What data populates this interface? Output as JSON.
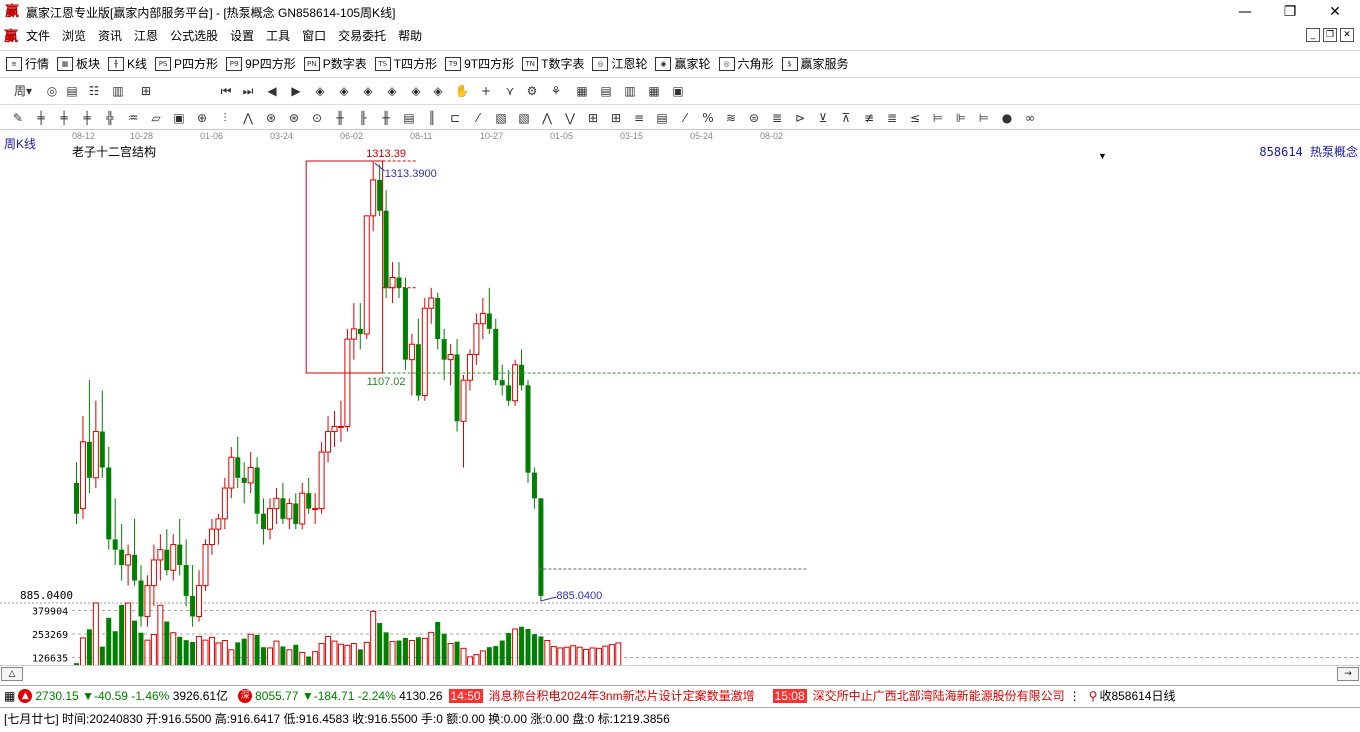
{
  "window": {
    "title": "赢家江恩专业版[赢家内部服务平台] - [热泵概念  GN858614-105周K线]",
    "app_logo": "赢"
  },
  "menu": {
    "logo": "赢",
    "items": [
      "文件",
      "浏览",
      "资讯",
      "江恩",
      "公式选股",
      "设置",
      "工具",
      "窗口",
      "交易委托",
      "帮助"
    ]
  },
  "toolbar1": {
    "items": [
      {
        "icon": "list-icon",
        "glyph": "≡",
        "label": "行情"
      },
      {
        "icon": "grid-icon",
        "glyph": "▦",
        "label": "板块"
      },
      {
        "icon": "kline-icon",
        "glyph": "╫",
        "label": "K线"
      },
      {
        "icon": "ps-icon",
        "glyph": "PS",
        "label": "P四方形"
      },
      {
        "icon": "p9-icon",
        "glyph": "P9",
        "label": "9P四方形"
      },
      {
        "icon": "pn-icon",
        "glyph": "PN",
        "label": "P数字表"
      },
      {
        "icon": "ts-icon",
        "glyph": "TS",
        "label": "T四方形"
      },
      {
        "icon": "t9-icon",
        "glyph": "T9",
        "label": "9T四方形"
      },
      {
        "icon": "tn-icon",
        "glyph": "TN",
        "label": "T数字表"
      },
      {
        "icon": "gann-wheel-icon",
        "glyph": "◎",
        "label": "江恩轮"
      },
      {
        "icon": "winner-wheel-icon",
        "glyph": "◉",
        "label": "赢家轮"
      },
      {
        "icon": "hexagon-icon",
        "glyph": "◎",
        "label": "六角形"
      },
      {
        "icon": "dollar-icon",
        "glyph": "$",
        "label": "赢家服务"
      }
    ]
  },
  "toolbar2": {
    "period": "周"
  },
  "chart": {
    "period_label": "周K线",
    "indicator_name": "老子十二宫结构",
    "code_name": "858614 热泵概念",
    "date_ticks": [
      "08-12",
      "10-28",
      "01-06",
      "03-24",
      "06-02",
      "08-11",
      "10-27",
      "01-05",
      "03-15",
      "05-24",
      "08-02"
    ],
    "high_label": "1313.39",
    "high_price": "1313.3900",
    "box_low_label": "1107.02",
    "low_price": "885.0400",
    "price_axis_low": "885.0400",
    "vol_ticks": [
      "379904",
      "253269",
      "126635"
    ]
  },
  "chart_data": {
    "type": "bar",
    "title": "热泵概念  GN858614 周K线",
    "candles": [
      {
        "o": 1000,
        "h": 1020,
        "l": 960,
        "c": 970
      },
      {
        "o": 975,
        "h": 1065,
        "l": 965,
        "c": 1040
      },
      {
        "o": 1040,
        "h": 1100,
        "l": 990,
        "c": 1005
      },
      {
        "o": 1005,
        "h": 1080,
        "l": 995,
        "c": 1050
      },
      {
        "o": 1050,
        "h": 1090,
        "l": 1005,
        "c": 1015
      },
      {
        "o": 1015,
        "h": 1035,
        "l": 935,
        "c": 945
      },
      {
        "o": 945,
        "h": 985,
        "l": 920,
        "c": 935
      },
      {
        "o": 935,
        "h": 960,
        "l": 905,
        "c": 920
      },
      {
        "o": 920,
        "h": 940,
        "l": 900,
        "c": 930
      },
      {
        "o": 930,
        "h": 965,
        "l": 900,
        "c": 905
      },
      {
        "o": 905,
        "h": 920,
        "l": 860,
        "c": 870
      },
      {
        "o": 870,
        "h": 910,
        "l": 860,
        "c": 900
      },
      {
        "o": 900,
        "h": 940,
        "l": 880,
        "c": 925
      },
      {
        "o": 925,
        "h": 950,
        "l": 905,
        "c": 935
      },
      {
        "o": 935,
        "h": 955,
        "l": 910,
        "c": 915
      },
      {
        "o": 915,
        "h": 950,
        "l": 905,
        "c": 940
      },
      {
        "o": 940,
        "h": 965,
        "l": 910,
        "c": 920
      },
      {
        "o": 920,
        "h": 945,
        "l": 880,
        "c": 890
      },
      {
        "o": 890,
        "h": 920,
        "l": 860,
        "c": 870
      },
      {
        "o": 870,
        "h": 915,
        "l": 865,
        "c": 900
      },
      {
        "o": 900,
        "h": 945,
        "l": 895,
        "c": 940
      },
      {
        "o": 940,
        "h": 965,
        "l": 930,
        "c": 955
      },
      {
        "o": 955,
        "h": 970,
        "l": 940,
        "c": 965
      },
      {
        "o": 965,
        "h": 1005,
        "l": 955,
        "c": 995
      },
      {
        "o": 995,
        "h": 1035,
        "l": 985,
        "c": 1025
      },
      {
        "o": 1025,
        "h": 1045,
        "l": 995,
        "c": 1005
      },
      {
        "o": 1005,
        "h": 1020,
        "l": 980,
        "c": 1000
      },
      {
        "o": 1000,
        "h": 1030,
        "l": 990,
        "c": 1015
      },
      {
        "o": 1015,
        "h": 1025,
        "l": 960,
        "c": 970
      },
      {
        "o": 970,
        "h": 985,
        "l": 940,
        "c": 955
      },
      {
        "o": 955,
        "h": 985,
        "l": 945,
        "c": 975
      },
      {
        "o": 975,
        "h": 995,
        "l": 960,
        "c": 985
      },
      {
        "o": 985,
        "h": 1000,
        "l": 960,
        "c": 965
      },
      {
        "o": 965,
        "h": 985,
        "l": 955,
        "c": 980
      },
      {
        "o": 980,
        "h": 990,
        "l": 955,
        "c": 960
      },
      {
        "o": 960,
        "h": 1000,
        "l": 955,
        "c": 990
      },
      {
        "o": 990,
        "h": 1005,
        "l": 970,
        "c": 975
      },
      {
        "o": 975,
        "h": 990,
        "l": 960,
        "c": 975
      },
      {
        "o": 975,
        "h": 1040,
        "l": 970,
        "c": 1030
      },
      {
        "o": 1030,
        "h": 1065,
        "l": 1020,
        "c": 1050
      },
      {
        "o": 1050,
        "h": 1070,
        "l": 1035,
        "c": 1055
      },
      {
        "o": 1055,
        "h": 1080,
        "l": 1040,
        "c": 1055
      },
      {
        "o": 1055,
        "h": 1150,
        "l": 1050,
        "c": 1140
      },
      {
        "o": 1140,
        "h": 1175,
        "l": 1120,
        "c": 1150
      },
      {
        "o": 1150,
        "h": 1175,
        "l": 1130,
        "c": 1145
      },
      {
        "o": 1145,
        "h": 1260,
        "l": 1140,
        "c": 1260
      },
      {
        "o": 1260,
        "h": 1313.39,
        "l": 1245,
        "c": 1295
      },
      {
        "o": 1295,
        "h": 1310,
        "l": 1260,
        "c": 1265
      },
      {
        "o": 1265,
        "h": 1285,
        "l": 1180,
        "c": 1190
      },
      {
        "o": 1190,
        "h": 1215,
        "l": 1175,
        "c": 1200
      },
      {
        "o": 1200,
        "h": 1215,
        "l": 1180,
        "c": 1190
      },
      {
        "o": 1190,
        "h": 1200,
        "l": 1110,
        "c": 1120
      },
      {
        "o": 1120,
        "h": 1145,
        "l": 1085,
        "c": 1135
      },
      {
        "o": 1135,
        "h": 1160,
        "l": 1080,
        "c": 1085
      },
      {
        "o": 1085,
        "h": 1180,
        "l": 1080,
        "c": 1170
      },
      {
        "o": 1170,
        "h": 1190,
        "l": 1155,
        "c": 1180
      },
      {
        "o": 1180,
        "h": 1185,
        "l": 1130,
        "c": 1140
      },
      {
        "o": 1140,
        "h": 1150,
        "l": 1100,
        "c": 1120
      },
      {
        "o": 1120,
        "h": 1135,
        "l": 1095,
        "c": 1125
      },
      {
        "o": 1125,
        "h": 1140,
        "l": 1050,
        "c": 1060
      },
      {
        "o": 1060,
        "h": 1105,
        "l": 1015,
        "c": 1100
      },
      {
        "o": 1100,
        "h": 1130,
        "l": 1090,
        "c": 1125
      },
      {
        "o": 1125,
        "h": 1165,
        "l": 1115,
        "c": 1155
      },
      {
        "o": 1155,
        "h": 1180,
        "l": 1140,
        "c": 1165
      },
      {
        "o": 1165,
        "h": 1190,
        "l": 1145,
        "c": 1150
      },
      {
        "o": 1150,
        "h": 1160,
        "l": 1095,
        "c": 1100
      },
      {
        "o": 1100,
        "h": 1115,
        "l": 1085,
        "c": 1095
      },
      {
        "o": 1095,
        "h": 1110,
        "l": 1075,
        "c": 1080
      },
      {
        "o": 1080,
        "h": 1120,
        "l": 1075,
        "c": 1115
      },
      {
        "o": 1115,
        "h": 1130,
        "l": 1090,
        "c": 1095
      },
      {
        "o": 1095,
        "h": 1100,
        "l": 1000,
        "c": 1010
      },
      {
        "o": 1010,
        "h": 1015,
        "l": 975,
        "c": 985
      },
      {
        "o": 985,
        "h": 985,
        "l": 885.04,
        "c": 890
      }
    ],
    "volumes": [
      96000,
      232000,
      278000,
      420000,
      185000,
      340000,
      268000,
      410000,
      420000,
      325000,
      260000,
      220000,
      250000,
      408000,
      320000,
      260000,
      238000,
      220000,
      210000,
      240000,
      220000,
      235000,
      205000,
      218000,
      168000,
      208000,
      228000,
      252000,
      248000,
      182000,
      178000,
      215000,
      186000,
      168000,
      195000,
      154000,
      132000,
      158000,
      202000,
      240000,
      215000,
      198000,
      192000,
      202000,
      170000,
      208000,
      375000,
      312000,
      262000,
      212000,
      218000,
      232000,
      218000,
      236000,
      230000,
      262000,
      318000,
      255000,
      202000,
      212000,
      176000,
      130000,
      142000,
      162000,
      182000,
      188000,
      218000,
      258000,
      280000,
      292000,
      280000,
      252000,
      240000,
      218000,
      185000,
      178000,
      182000,
      190000,
      182000,
      170000,
      178000,
      176000,
      188000,
      196000,
      205000
    ],
    "ylim": [
      885.04,
      1313.39
    ],
    "vol_ylim": [
      0,
      420000
    ]
  },
  "status1": {
    "idx1_value": "2730.15",
    "idx1_change": "▼-40.59",
    "idx1_pct": "-1.46%",
    "idx1_amount": "3926.61亿",
    "idx2_value": "8055.77",
    "idx2_change": "▼-184.71",
    "idx2_pct": "-2.24%",
    "idx2_amount": "4130.26",
    "news1_time": "14:50",
    "news1_text": "消息称台积电2024年3nm新芯片设计定案数量激增",
    "news2_time": "15:08",
    "news2_text": "深交所中止广西北部湾陆海新能源股份有限公司",
    "right_text": "收858614日线",
    "idx2_icon": "深"
  },
  "status2": {
    "text": "[七月廿七] 时间:20240830 开:916.5500 高:916.6417 低:916.4583 收:916.5500 手:0 额:0.00 换:0.00 涨:0.00 盘:0 标:1219.3856"
  },
  "colors": {
    "up": "#e00000",
    "down": "#008000",
    "box": "#d00000",
    "low_line": "#3030c0"
  }
}
